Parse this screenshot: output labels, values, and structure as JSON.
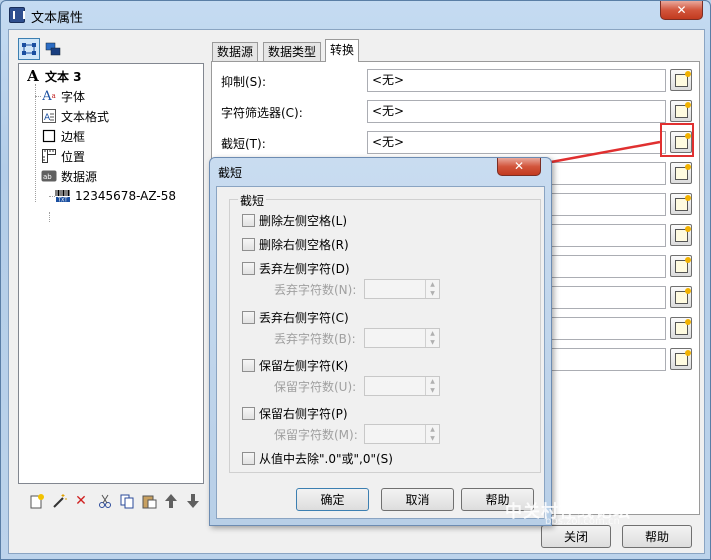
{
  "window": {
    "title": "文本属性",
    "close_glyph": "✕"
  },
  "left_panel": {
    "tree": [
      {
        "label": "文本 3",
        "icon": "text-a-icon"
      },
      {
        "label": "字体",
        "icon": "font-icon"
      },
      {
        "label": "文本格式",
        "icon": "text-format-icon"
      },
      {
        "label": "边框",
        "icon": "border-icon"
      },
      {
        "label": "位置",
        "icon": "ruler-icon"
      },
      {
        "label": "数据源",
        "icon": "datasource-icon"
      },
      {
        "label": "12345678-AZ-58",
        "icon": "barcode-text-icon"
      }
    ]
  },
  "tabs": [
    {
      "label": "数据源"
    },
    {
      "label": "数据类型"
    },
    {
      "label": "转换"
    }
  ],
  "properties": [
    {
      "label": "抑制(S):",
      "value": "<无>"
    },
    {
      "label": "字符筛选器(C):",
      "value": "<无>"
    },
    {
      "label": "截短(T):",
      "value": "<无>"
    }
  ],
  "main_footer": {
    "close": "关闭",
    "help": "帮助"
  },
  "dialog": {
    "title": "截短",
    "close_glyph": "✕",
    "group_title": "截短",
    "options": [
      {
        "label": "删除左侧空格(L)"
      },
      {
        "label": "删除右侧空格(R)"
      },
      {
        "label": "丢弃左侧字符(D)",
        "sub_label": "丢弃字符数(N):"
      },
      {
        "label": "丢弃右侧字符(C)",
        "sub_label": "丢弃字符数(B):"
      },
      {
        "label": "保留左侧字符(K)",
        "sub_label": "保留字符数(U):"
      },
      {
        "label": "保留右侧字符(P)",
        "sub_label": "保留字符数(M):"
      },
      {
        "label": "从值中去除\".0\"或\",0\"(S)"
      }
    ],
    "ok": "确定",
    "cancel": "取消",
    "help": "帮助"
  },
  "watermark": {
    "text": "中关村在线论坛",
    "sub": "bbs.zol.com.cn"
  },
  "colors": {
    "annotation": "#e03030",
    "title_bg": "#c5dbf2"
  }
}
